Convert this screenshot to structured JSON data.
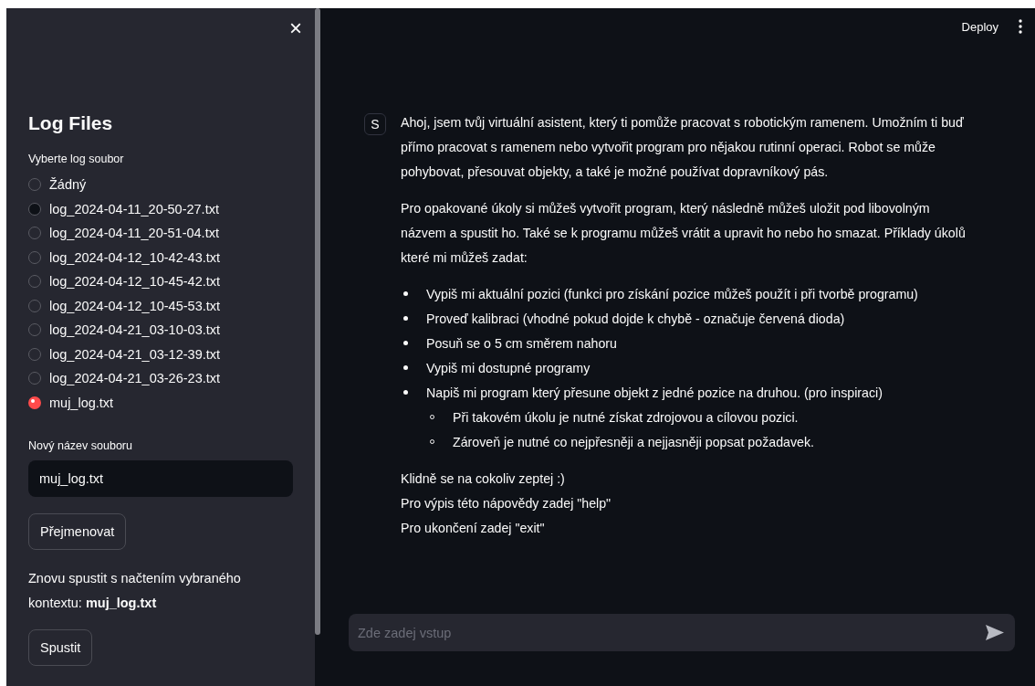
{
  "sidebar": {
    "close": "×",
    "title": "Log Files",
    "radio_label": "Vyberte log soubor",
    "options": [
      {
        "label": "Žádný",
        "selected": false,
        "hover": false
      },
      {
        "label": "log_2024-04-11_20-50-27.txt",
        "selected": false,
        "hover": true
      },
      {
        "label": "log_2024-04-11_20-51-04.txt",
        "selected": false,
        "hover": false
      },
      {
        "label": "log_2024-04-12_10-42-43.txt",
        "selected": false,
        "hover": false
      },
      {
        "label": "log_2024-04-12_10-45-42.txt",
        "selected": false,
        "hover": false
      },
      {
        "label": "log_2024-04-12_10-45-53.txt",
        "selected": false,
        "hover": false
      },
      {
        "label": "log_2024-04-21_03-10-03.txt",
        "selected": false,
        "hover": false
      },
      {
        "label": "log_2024-04-21_03-12-39.txt",
        "selected": false,
        "hover": false
      },
      {
        "label": "log_2024-04-21_03-26-23.txt",
        "selected": false,
        "hover": false
      },
      {
        "label": "muj_log.txt",
        "selected": true,
        "hover": false
      }
    ],
    "rename_label": "Nový název souboru",
    "rename_value": "muj_log.txt",
    "rename_button": "Přejmenovat",
    "restart_text": "Znovu spustit s načtením vybraného kontextu: **muj_log.txt**",
    "restart_button": "Spustit"
  },
  "header": {
    "deploy": "Deploy"
  },
  "message": {
    "avatar": "S",
    "paragraphs": [
      "Ahoj, jsem tvůj virtuální asistent, který ti pomůže pracovat s robotickým ramenem. Umožním ti buď přímo pracovat s ramenem nebo vytvořit program pro nějakou rutinní operaci. Robot se může pohybovat, přesouvat objekty, a také je možné používat dopravníkový pás.",
      "Pro opakované úkoly si můžeš vytvořit program, který následně můžeš uložit pod libovolným názvem a spustit ho. Také se k programu můžeš vrátit a upravit ho nebo ho smazat. Příklady úkolů které mi můžeš zadat:"
    ],
    "bullets": [
      {
        "text": "Vypiš mi aktuální pozici (funkci pro získání pozice můžeš použít i při tvorbě programu)"
      },
      {
        "text": "Proveď kalibraci (vhodné pokud dojde k chybě - označuje červená dioda)"
      },
      {
        "text": "Posuň se o 5 cm směrem nahoru"
      },
      {
        "text": "Vypiš mi dostupné programy"
      },
      {
        "text": "Napiš mi program který přesune objekt z jedné pozice na druhou. (pro inspiraci)",
        "children": [
          "Při takovém úkolu je nutné získat zdrojovou a cílovou pozici.",
          "Zároveň je nutné co nejpřesněji a nejjasněji popsat požadavek."
        ]
      }
    ],
    "closing_lines": [
      "Klidně se na cokoliv zeptej :)",
      "Pro výpis této nápovědy zadej \"help\"",
      "Pro ukončení zadej \"exit\""
    ]
  },
  "chat_input": {
    "placeholder": "Zde zadej vstup"
  }
}
